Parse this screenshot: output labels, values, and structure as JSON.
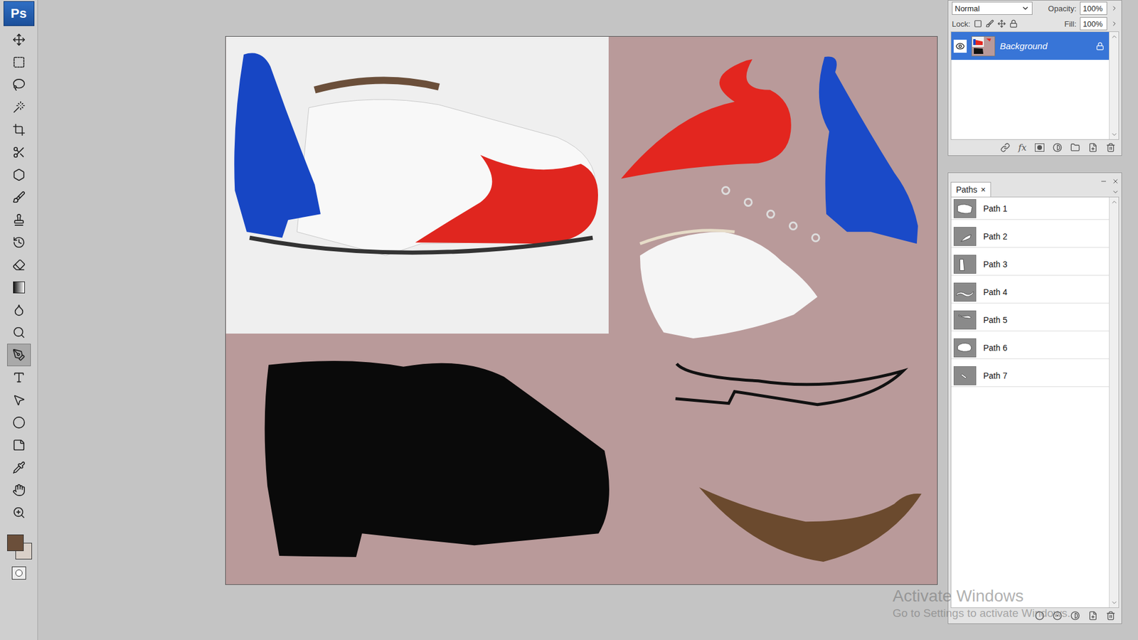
{
  "app": {
    "logo": "Ps"
  },
  "tools": [
    {
      "kind": "move",
      "selected": false
    },
    {
      "kind": "marquee",
      "selected": false
    },
    {
      "kind": "lasso",
      "selected": false
    },
    {
      "kind": "wand",
      "selected": false
    },
    {
      "kind": "crop",
      "selected": false
    },
    {
      "kind": "slice",
      "selected": false
    },
    {
      "kind": "healing",
      "selected": false
    },
    {
      "kind": "brush",
      "selected": false
    },
    {
      "kind": "stamp",
      "selected": false
    },
    {
      "kind": "history",
      "selected": false
    },
    {
      "kind": "eraser",
      "selected": false
    },
    {
      "kind": "gradient",
      "selected": false
    },
    {
      "kind": "blur",
      "selected": false
    },
    {
      "kind": "dodge",
      "selected": false
    },
    {
      "kind": "pen",
      "selected": true
    },
    {
      "kind": "type",
      "selected": false
    },
    {
      "kind": "path-select",
      "selected": false
    },
    {
      "kind": "shape",
      "selected": false
    },
    {
      "kind": "notes",
      "selected": false
    },
    {
      "kind": "eyedropper",
      "selected": false
    },
    {
      "kind": "hand",
      "selected": false
    },
    {
      "kind": "zoom",
      "selected": false
    }
  ],
  "colors": {
    "foreground": "#6b4f3a",
    "background": "#d9d0c8"
  },
  "layers": {
    "blend_mode": "Normal",
    "opacity_label": "Opacity:",
    "opacity": "100%",
    "lock_label": "Lock:",
    "fill_label": "Fill:",
    "fill": "100%",
    "fx_label": "fx",
    "items": [
      {
        "name": "Background",
        "visible": true,
        "locked": true,
        "selected": true
      }
    ]
  },
  "paths": {
    "tab": "Paths",
    "close": "×",
    "items": [
      {
        "name": "Path 1",
        "selected": false
      },
      {
        "name": "Path 2",
        "selected": false
      },
      {
        "name": "Path 3",
        "selected": false
      },
      {
        "name": "Path 4",
        "selected": false
      },
      {
        "name": "Path 5",
        "selected": false
      },
      {
        "name": "Path 6",
        "selected": false
      },
      {
        "name": "Path 7",
        "selected": false
      }
    ]
  },
  "watermark": {
    "title": "Activate Windows",
    "subtitle": "Go to Settings to activate Windows."
  }
}
